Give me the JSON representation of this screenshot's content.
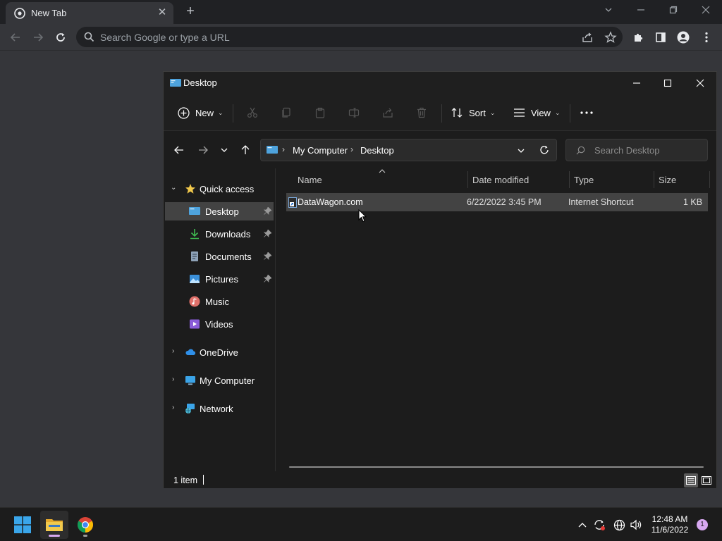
{
  "browser": {
    "tab_title": "New Tab",
    "omnibox_placeholder": "Search Google or type a URL"
  },
  "explorer": {
    "window_title": "Desktop",
    "commands": {
      "new_label": "New",
      "sort_label": "Sort",
      "view_label": "View"
    },
    "breadcrumb": [
      "My Computer",
      "Desktop"
    ],
    "search_placeholder": "Search Desktop",
    "nav": {
      "quick_access": "Quick access",
      "pinned": [
        {
          "label": "Desktop",
          "pinned": true
        },
        {
          "label": "Downloads",
          "pinned": true
        },
        {
          "label": "Documents",
          "pinned": true
        },
        {
          "label": "Pictures",
          "pinned": true
        },
        {
          "label": "Music",
          "pinned": false
        },
        {
          "label": "Videos",
          "pinned": false
        }
      ],
      "onedrive": "OneDrive",
      "my_computer": "My Computer",
      "network": "Network"
    },
    "columns": {
      "name": "Name",
      "date": "Date modified",
      "type": "Type",
      "size": "Size"
    },
    "files": [
      {
        "name": "DataWagon.com",
        "date": "6/22/2022 3:45 PM",
        "type": "Internet Shortcut",
        "size": "1 KB"
      }
    ],
    "status": "1 item"
  },
  "taskbar": {
    "time": "12:48 AM",
    "date": "11/6/2022",
    "notification_count": "1"
  },
  "colors": {
    "accent_folder": "#f2c94c",
    "selection_bg": "#434343",
    "taskbar_bg": "#1c1c1c"
  }
}
